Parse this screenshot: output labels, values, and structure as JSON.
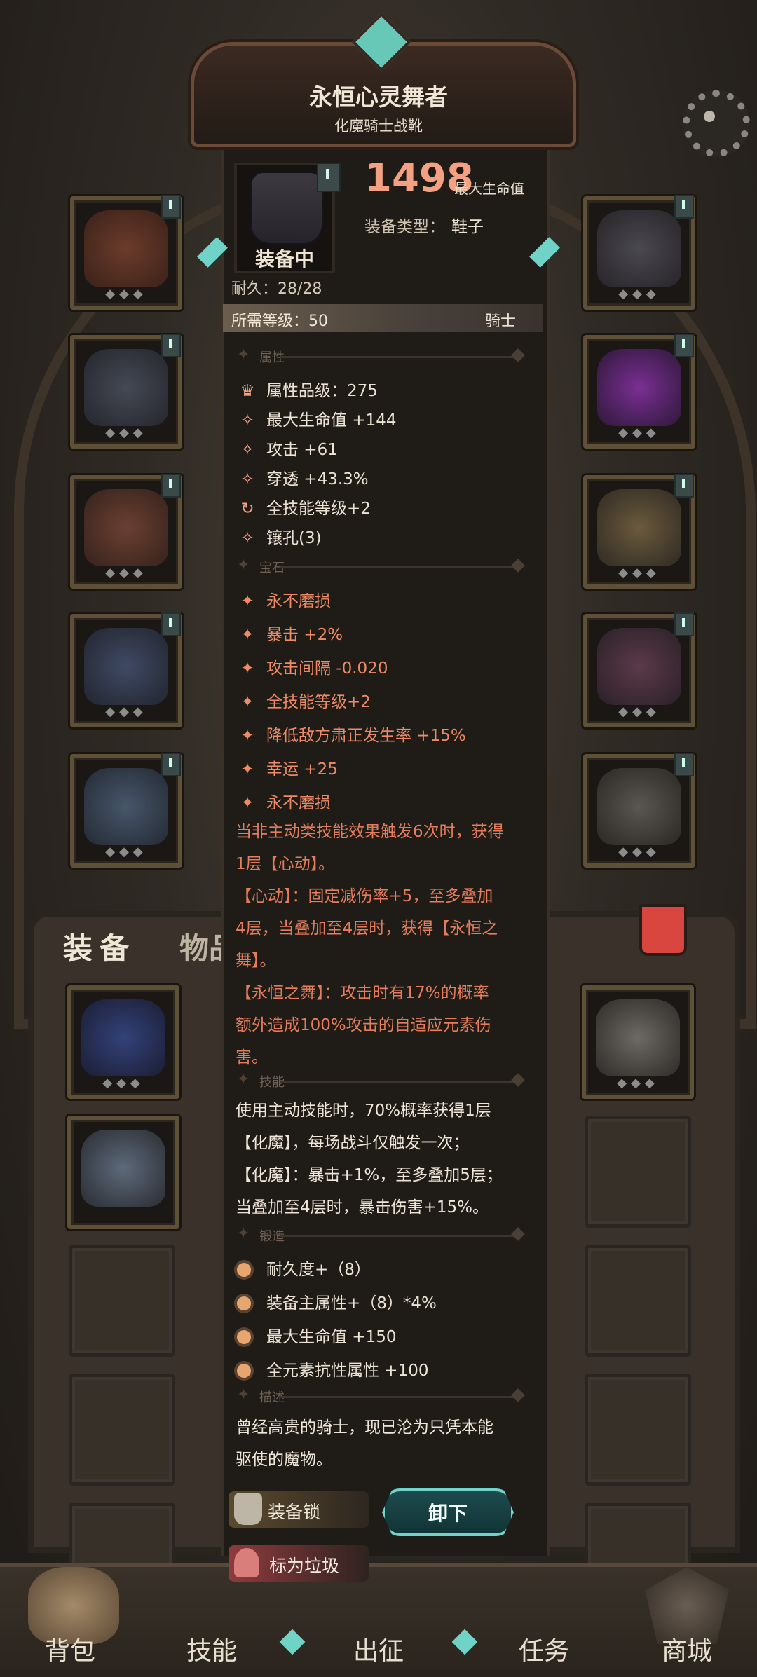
{
  "item": {
    "name": "永恒心灵舞者",
    "subtitle": "化魔骑士战靴",
    "max_hp_value": "1498",
    "max_hp_label": "最大生命值",
    "type_label": "装备类型：",
    "type_value": "鞋子",
    "equipped_label": "装备中",
    "durability": "耐久：28/28",
    "required_level": "所需等级：50",
    "required_class": "骑士"
  },
  "sections": {
    "attributes": "属性",
    "gems": "宝石",
    "skills": "技能",
    "forging": "锻造",
    "description": "描述"
  },
  "attributes": [
    {
      "icon": "quality-crest-icon",
      "text": "属性品级：275"
    },
    {
      "icon": "spark-icon",
      "text": "最大生命值 +144"
    },
    {
      "icon": "spark-icon",
      "text": "攻击 +61"
    },
    {
      "icon": "spark-icon",
      "text": "穿透 +43.3%"
    },
    {
      "icon": "cycle-icon",
      "text": "全技能等级+2"
    },
    {
      "icon": "spark-icon",
      "text": "镶孔(3)"
    }
  ],
  "gems": [
    "永不磨损",
    "暴击 +2%",
    "攻击间隔 -0.020",
    "全技能等级+2",
    "降低敌方肃正发生率 +15%",
    "幸运 +25",
    "永不磨损"
  ],
  "gem_effect_lines": [
    "当非主动类技能效果触发6次时，获得",
    "1层【心动】。",
    "【心动】：固定减伤率+5，至多叠加",
    "4层，当叠加至4层时，获得【永恒之",
    "舞】。",
    "【永恒之舞】：攻击时有17%的概率",
    "额外造成100%攻击的自适应元素伤",
    "害。"
  ],
  "skill_lines": [
    "使用主动技能时，70%概率获得1层",
    "【化魔】，每场战斗仅触发一次；",
    "【化魔】：暴击+1%，至多叠加5层；",
    "当叠加至4层时，暴击伤害+15%。"
  ],
  "forging": [
    "耐久度+（8）",
    "装备主属性+（8）*4%",
    "最大生命值 +150",
    "全元素抗性属性 +100"
  ],
  "description_lines": [
    "曾经高贵的骑士，现已沦为只凭本能",
    "驱使的魔物。"
  ],
  "buttons": {
    "lock": "装备锁",
    "unequip": "卸下",
    "junk": "标为垃圾"
  },
  "bag_tabs": {
    "equipment": "装备",
    "items": "物品"
  },
  "bottom_nav": [
    "背包",
    "技能",
    "出征",
    "任务",
    "商城"
  ],
  "colors": {
    "accent_red": "#e57d5d",
    "teal": "#6fd3c7",
    "panel_bg": "#1f1b17"
  }
}
